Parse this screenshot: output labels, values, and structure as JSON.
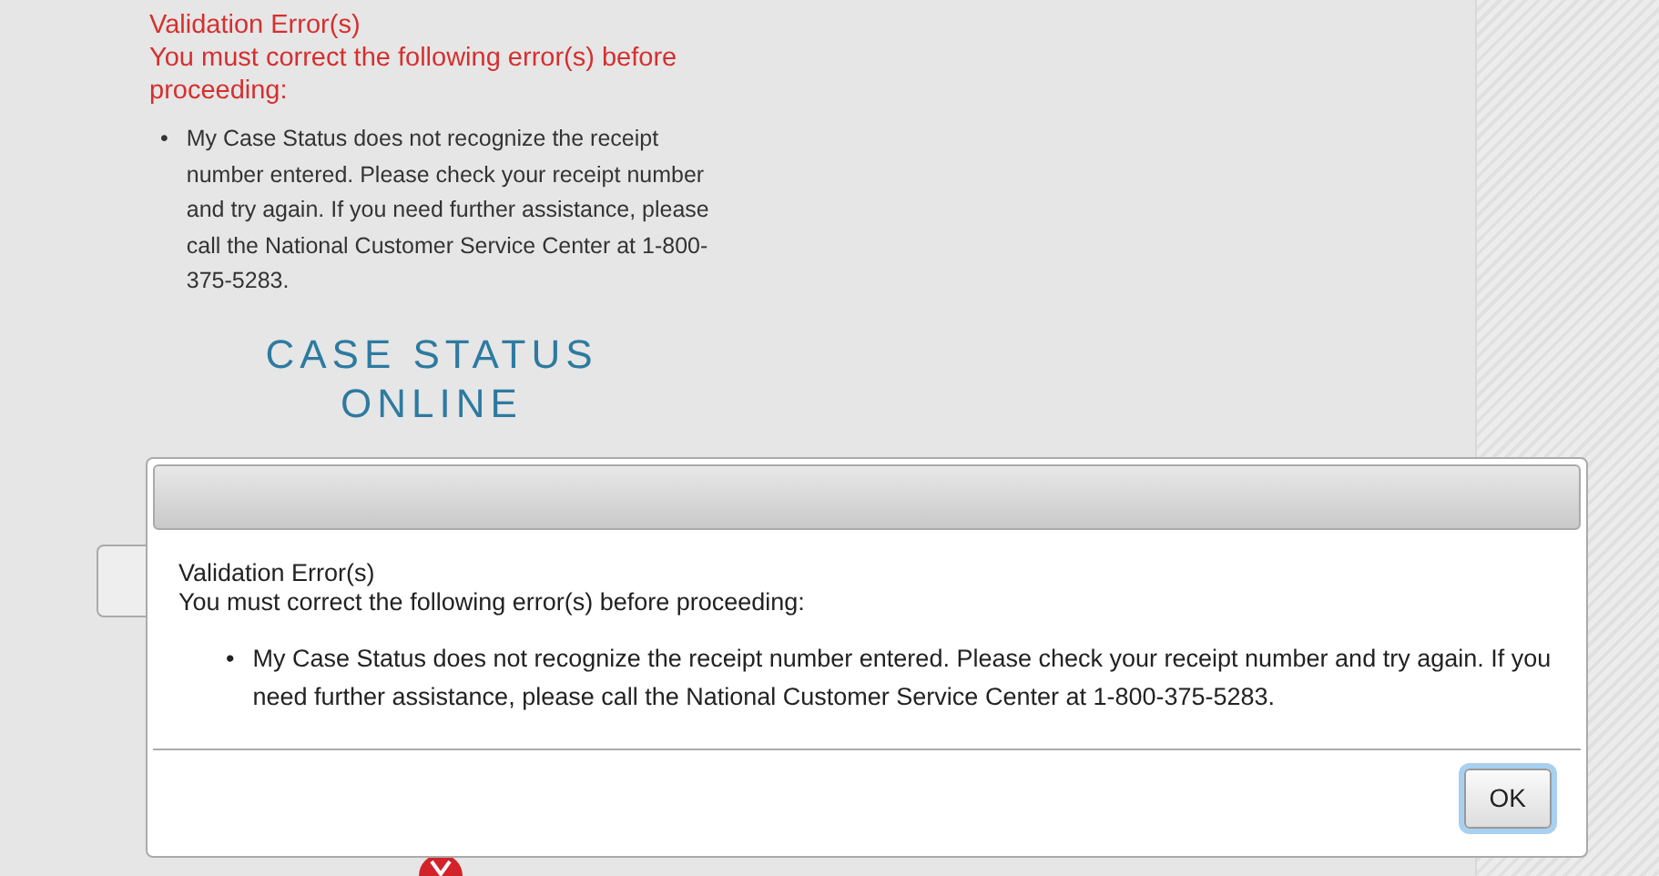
{
  "page": {
    "bullet": "•",
    "error_title": "Validation Error(s)",
    "error_intro": "You must correct the following error(s) before proceeding:",
    "errors": [
      "My Case Status does not recognize the receipt number entered. Please check your receipt number and try again. If you need further assistance, please call the National Customer Service Center at 1-800-375-5283."
    ],
    "heading_lines": [
      "CASE STATUS",
      "ONLINE"
    ]
  },
  "dialog": {
    "bullet": "•",
    "error_title": "Validation Error(s)",
    "error_intro": "You must correct the following error(s) before proceeding:",
    "errors": [
      "My Case Status does not recognize the receipt number entered. Please check your receipt number and try again. If you need further assistance, please call the National Customer Service Center at 1-800-375-5283."
    ],
    "buttons": [
      {
        "label": "OK",
        "focused": true
      }
    ]
  }
}
